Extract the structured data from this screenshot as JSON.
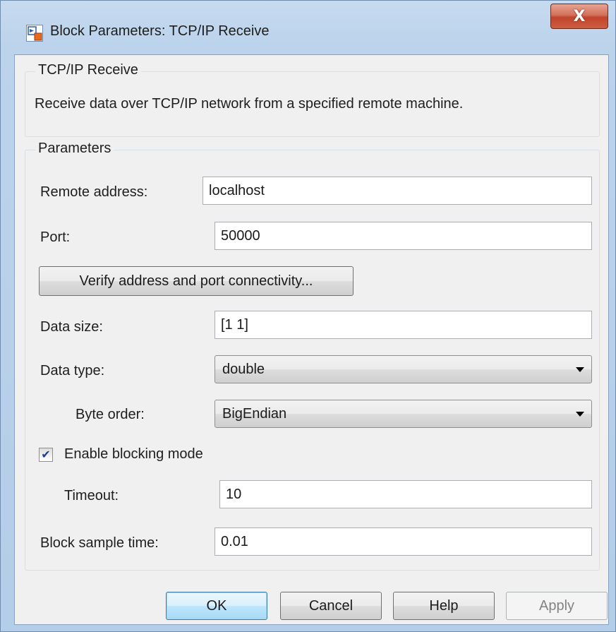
{
  "window": {
    "title": "Block Parameters: TCP/IP Receive",
    "close_glyph": "X"
  },
  "block": {
    "group_title": "TCP/IP Receive",
    "description": "Receive data over TCP/IP network from a specified remote machine."
  },
  "parameters": {
    "group_title": "Parameters",
    "remote_address": {
      "label": "Remote address:",
      "value": "localhost"
    },
    "port": {
      "label": "Port:",
      "value": "50000"
    },
    "verify_button": "Verify address and port connectivity...",
    "data_size": {
      "label": "Data size:",
      "value": "[1 1]"
    },
    "data_type": {
      "label": "Data type:",
      "selected": "double"
    },
    "byte_order": {
      "label": "Byte order:",
      "selected": "BigEndian"
    },
    "blocking_mode": {
      "label": "Enable blocking mode",
      "checked": true
    },
    "timeout": {
      "label": "Timeout:",
      "value": "10"
    },
    "sample_time": {
      "label": "Block sample time:",
      "value": "0.01"
    }
  },
  "buttons": {
    "ok": "OK",
    "cancel": "Cancel",
    "help": "Help",
    "apply": "Apply"
  },
  "colors": {
    "window_frame": "#b9d1ea",
    "client_background": "#f0f0f0",
    "close_button": "#c7503a",
    "default_button_border": "#3c7fb1"
  },
  "icons": {
    "app": "simulink-block-icon",
    "close": "close-icon",
    "dropdown": "chevron-down-icon",
    "checkbox": "checkmark-icon"
  }
}
